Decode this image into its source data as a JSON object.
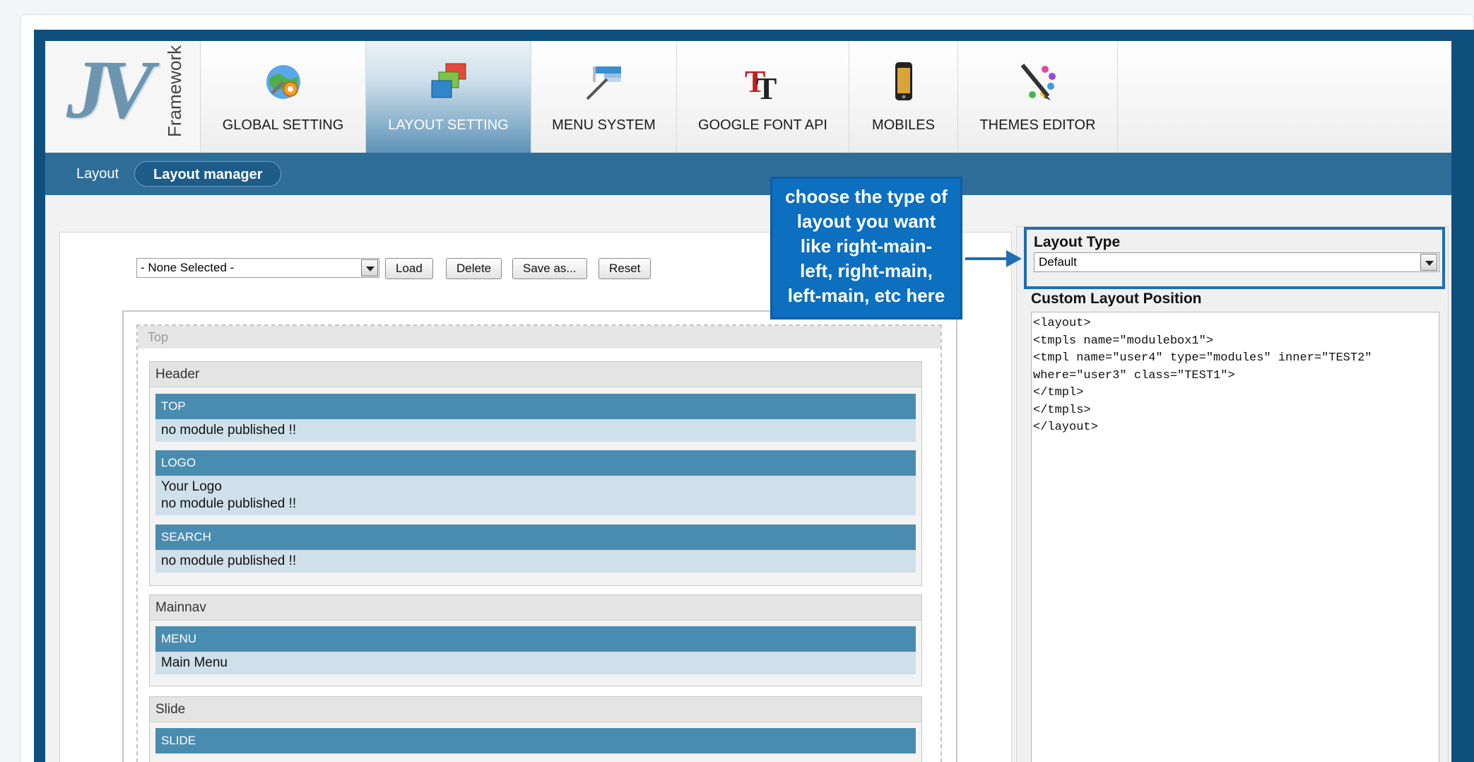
{
  "logo": {
    "letters": "JV",
    "word": "Framework"
  },
  "tabs": [
    {
      "label": "GLOBAL SETTING",
      "icon": "globe-gear-icon"
    },
    {
      "label": "LAYOUT SETTING",
      "icon": "layered-windows-icon"
    },
    {
      "label": "MENU SYSTEM",
      "icon": "menu-wand-icon"
    },
    {
      "label": "GOOGLE FONT API",
      "icon": "font-tt-icon"
    },
    {
      "label": "MOBILES",
      "icon": "mobile-phone-icon"
    },
    {
      "label": "THEMES EDITOR",
      "icon": "pencil-palette-icon"
    }
  ],
  "active_tab": "LAYOUT SETTING",
  "subnav": {
    "item1": "Layout",
    "item2": "Layout manager"
  },
  "toolbar": {
    "select_value": "- None Selected -",
    "load": "Load",
    "delete": "Delete",
    "save_as": "Save as...",
    "reset": "Reset"
  },
  "layout": {
    "top_title": "Top",
    "groups": [
      {
        "title": "Header",
        "modules": [
          {
            "name": "TOP",
            "body": "no module published !!"
          },
          {
            "name": "LOGO",
            "body1": "Your Logo",
            "body2": "no module published !!"
          },
          {
            "name": "SEARCH",
            "body": "no module published !!"
          }
        ]
      },
      {
        "title": "Mainnav",
        "modules": [
          {
            "name": "MENU",
            "body": "Main Menu"
          }
        ]
      },
      {
        "title": "Slide",
        "modules": [
          {
            "name": "SLIDE"
          }
        ]
      }
    ]
  },
  "right": {
    "layout_type_label": "Layout Type",
    "layout_type_value": "Default",
    "custom_label": "Custom Layout Position",
    "custom_text": "<layout>\n<tmpls name=\"modulebox1\">\n<tmpl name=\"user4\" type=\"modules\" inner=\"TEST2\"\nwhere=\"user3\" class=\"TEST1\">\n</tmpl>\n</tmpls>\n</layout>"
  },
  "callout": {
    "line1": "choose the type of",
    "line2": "layout you want",
    "line3": "like right-main-",
    "line4": "left, right-main,",
    "line5": "left-main, etc here"
  },
  "colors": {
    "frame_blue": "#0f4f7e",
    "subnav_blue": "#2f6d99",
    "module_head": "#4a8cb0",
    "module_body": "#cfe0eb",
    "callout_blue": "#0c6fc0"
  }
}
